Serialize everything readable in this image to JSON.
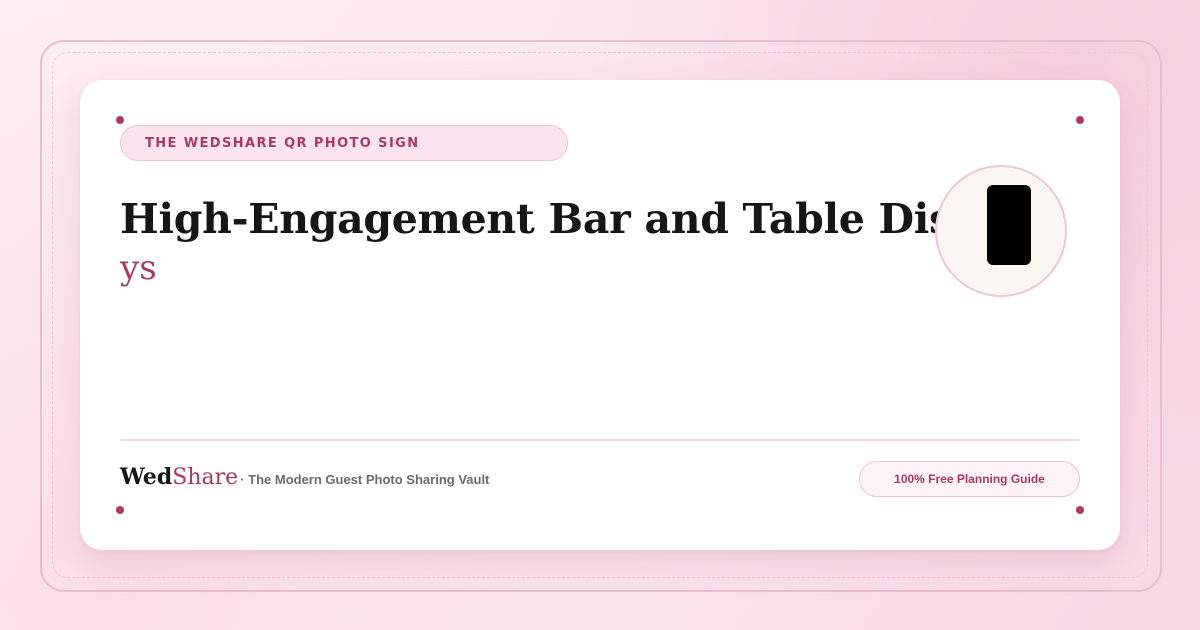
{
  "eyebrow": {
    "label": "THE WEDSHARE QR PHOTO SIGN"
  },
  "headline": {
    "main": "High-Engagement Bar and Table Displa...",
    "overflow": "ys"
  },
  "badge": {
    "icon": "phone-icon"
  },
  "brand": {
    "name_part1": "Wed",
    "name_part2": "Share",
    "tagline": "· The Modern Guest Photo Sharing Vault"
  },
  "cta": {
    "label": "100% Free Planning Guide"
  },
  "colors": {
    "accent": "#a83a64",
    "background": "#fbe7ee",
    "card": "#ffffff",
    "text": "#161616"
  }
}
